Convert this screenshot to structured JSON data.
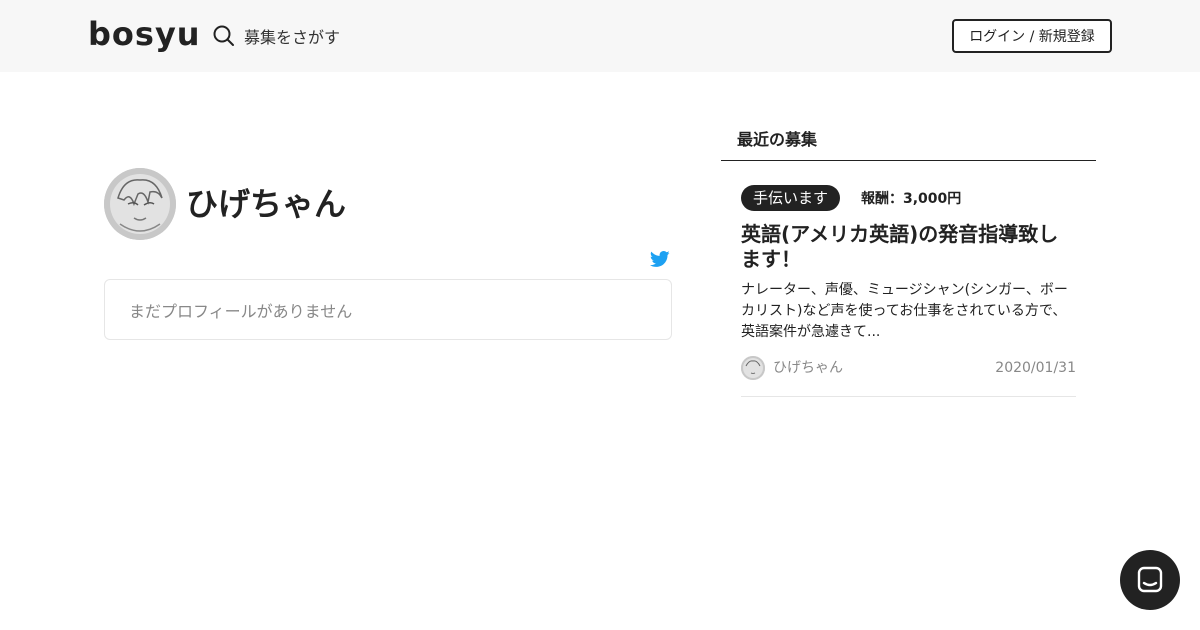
{
  "header": {
    "logo": "bosyu",
    "search_label": "募集をさがす",
    "login_label": "ログイン / 新規登録"
  },
  "profile": {
    "name": "ひげちゃん",
    "empty_profile_text": "まだプロフィールがありません"
  },
  "recent": {
    "title": "最近の募集",
    "posts": [
      {
        "tag": "手伝います",
        "reward": "報酬：3,000円",
        "title": "英語(アメリカ英語)の発音指導致します！",
        "description": "ナレーター、声優、ミュージシャン(シンガー、ボーカリスト)など声を使ってお仕事をされている方で、英語案件が急遽きて...",
        "user": "ひげちゃん",
        "date": "2020/01/31"
      }
    ]
  },
  "icons": {
    "search": "search-icon",
    "twitter": "twitter-icon",
    "chat": "chat-icon"
  },
  "colors": {
    "header_bg": "#f7f7f7",
    "text": "#222222",
    "muted": "#888888",
    "twitter": "#1da1f2"
  }
}
